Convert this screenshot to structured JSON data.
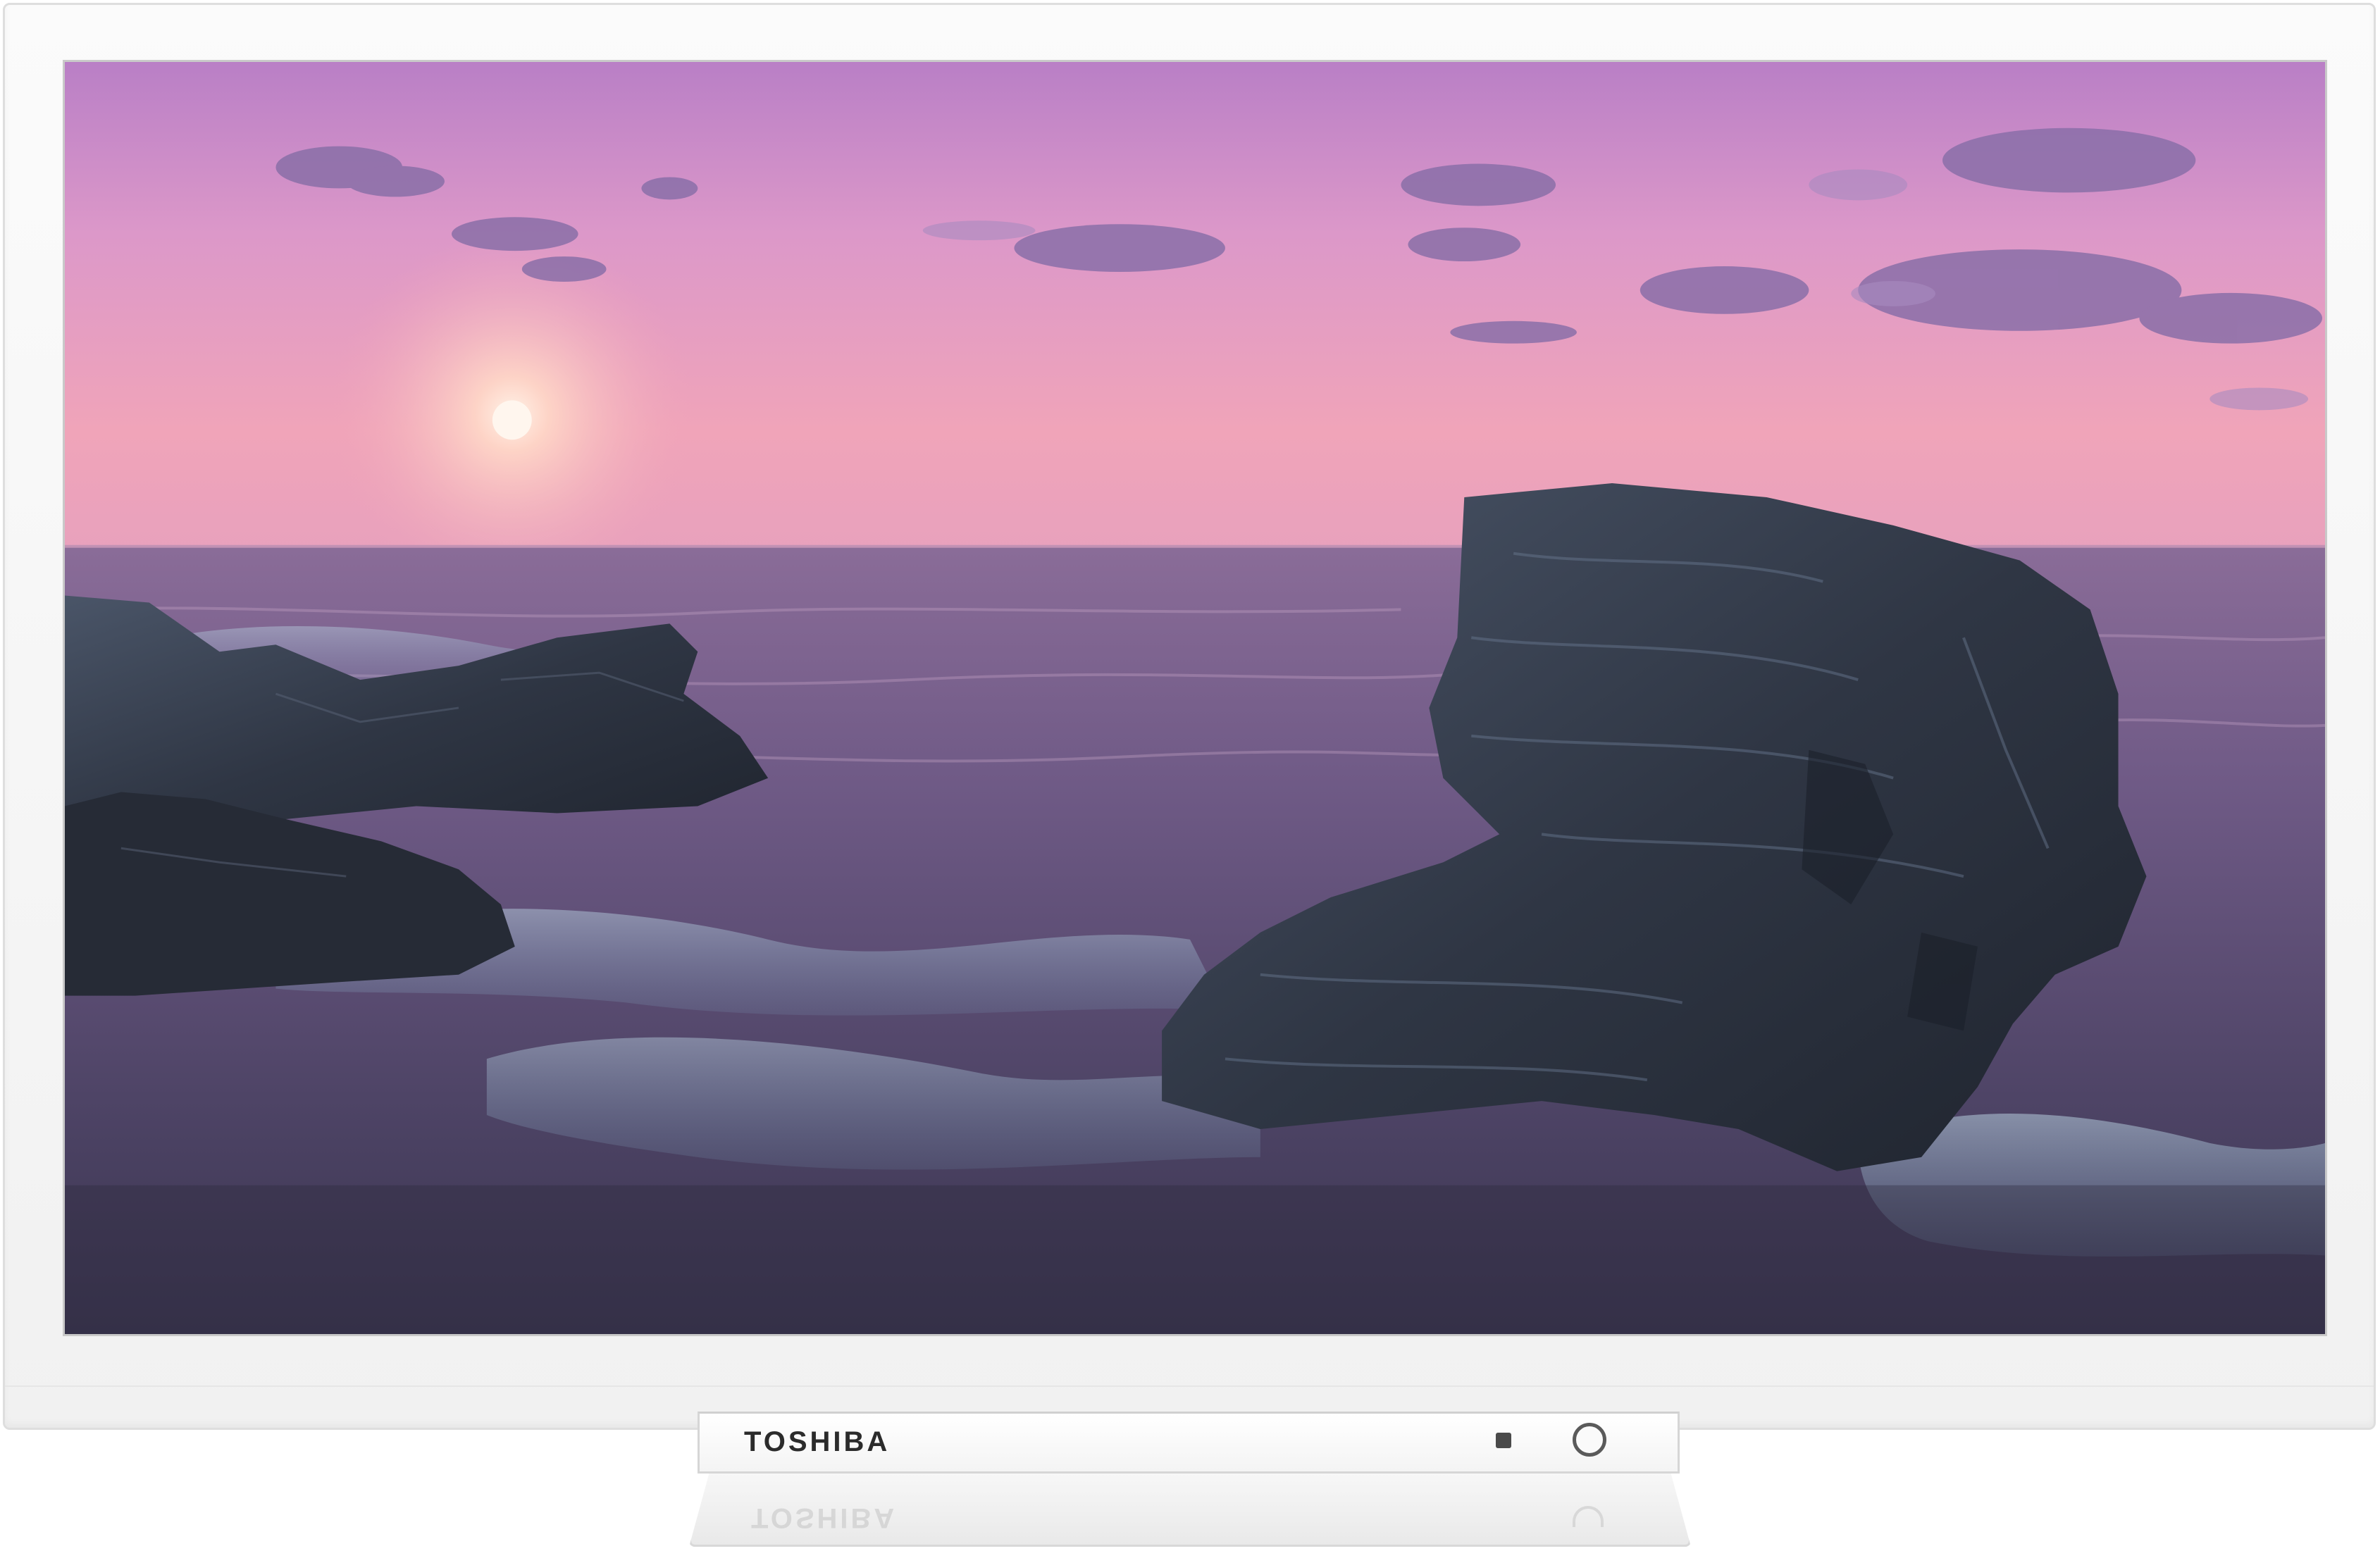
{
  "tv": {
    "brand": "TOSHIBA",
    "bezel_color": "#f5f5f5",
    "power_icon": "power-icon",
    "led_icon": "standby-led"
  },
  "screen": {
    "scene": "sunset-seascape",
    "sky_top_color": "#c98ad0",
    "sky_horizon_color": "#f2a3b8",
    "sea_color": "#6d5a86",
    "rock_color": "#2e3440"
  }
}
